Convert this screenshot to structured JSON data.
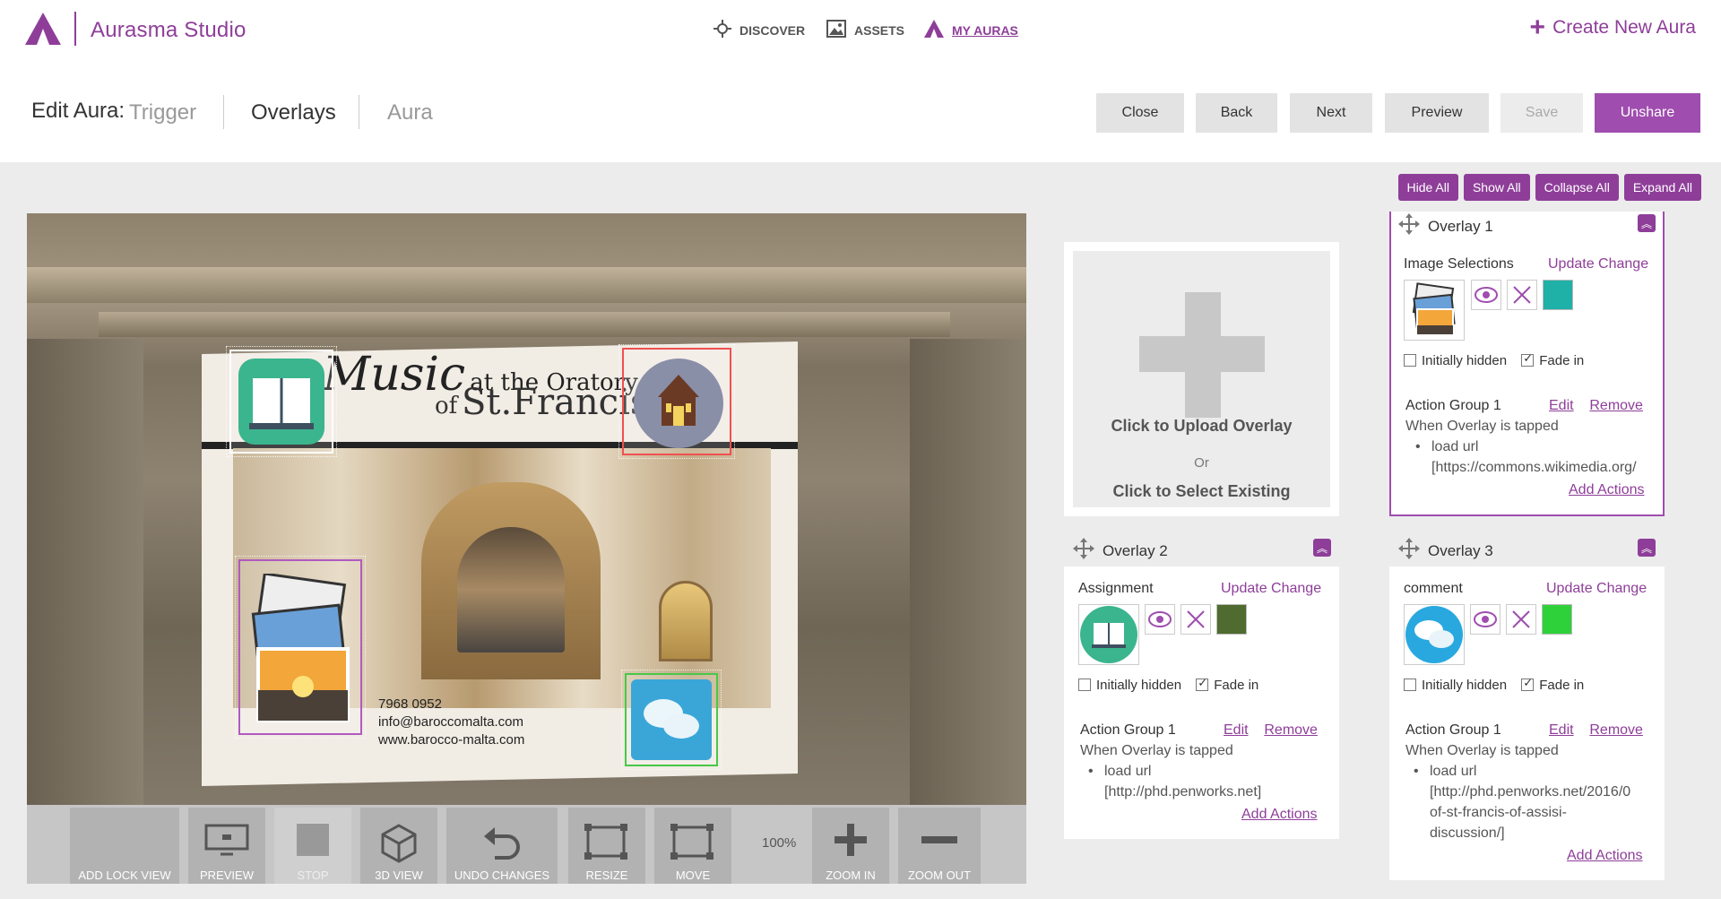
{
  "app": {
    "title": "Aurasma Studio"
  },
  "nav": {
    "discover": "DISCOVER",
    "assets": "ASSETS",
    "my_auras": "MY AURAS",
    "create_new": "Create New Aura"
  },
  "edit": {
    "label": "Edit Aura:",
    "steps": {
      "trigger": "Trigger",
      "overlays": "Overlays",
      "aura": "Aura"
    },
    "buttons": {
      "close": "Close",
      "back": "Back",
      "next": "Next",
      "preview": "Preview",
      "save": "Save",
      "unshare": "Unshare"
    }
  },
  "top_actions": {
    "hide_all": "Hide All",
    "show_all": "Show All",
    "collapse_all": "Collapse All",
    "expand_all": "Expand All"
  },
  "poster": {
    "script": "Music",
    "line1": "at the Oratory",
    "line2a": "of",
    "line2b": "St.Francis",
    "phone": "7968 0952",
    "email": "info@baroccomalta.com",
    "web": "www.barocco-malta.com"
  },
  "toolbar": {
    "add_lock_view": "ADD LOCK VIEW",
    "preview": "PREVIEW",
    "stop": "STOP",
    "view_3d": "3D VIEW",
    "undo": "UNDO CHANGES",
    "resize": "RESIZE",
    "move": "MOVE",
    "zoom_level": "100%",
    "zoom_in": "ZOOM IN",
    "zoom_out": "ZOOM OUT"
  },
  "upload": {
    "upload_label": "Click to Upload Overlay",
    "or": "Or",
    "select_label": "Click to Select Existing"
  },
  "common": {
    "update": "Update",
    "change": "Change",
    "initially_hidden": "Initially hidden",
    "fade_in": "Fade in",
    "action_group": "Action Group 1",
    "edit": "Edit",
    "remove": "Remove",
    "when_tapped": "When Overlay is tapped",
    "load_url": "load url",
    "add_actions": "Add Actions"
  },
  "overlays": [
    {
      "title": "Overlay 1",
      "name": "Image Selections",
      "color": "#1fb0a8",
      "initially_hidden": false,
      "fade_in": true,
      "url_lines": [
        "[https://commons.wikimedia.org/"
      ]
    },
    {
      "title": "Overlay 2",
      "name": "Assignment",
      "color": "#4f6b2f",
      "initially_hidden": false,
      "fade_in": true,
      "url_lines": [
        "[http://phd.penworks.net]"
      ]
    },
    {
      "title": "Overlay 3",
      "name": "comment",
      "color": "#2ed13a",
      "initially_hidden": false,
      "fade_in": true,
      "url_lines": [
        "[http://phd.penworks.net/2016/0",
        "of-st-francis-of-assisi-",
        "discussion/]"
      ]
    }
  ],
  "colors": {
    "brand": "#8e3e99",
    "accent_button": "#9f4daf"
  }
}
